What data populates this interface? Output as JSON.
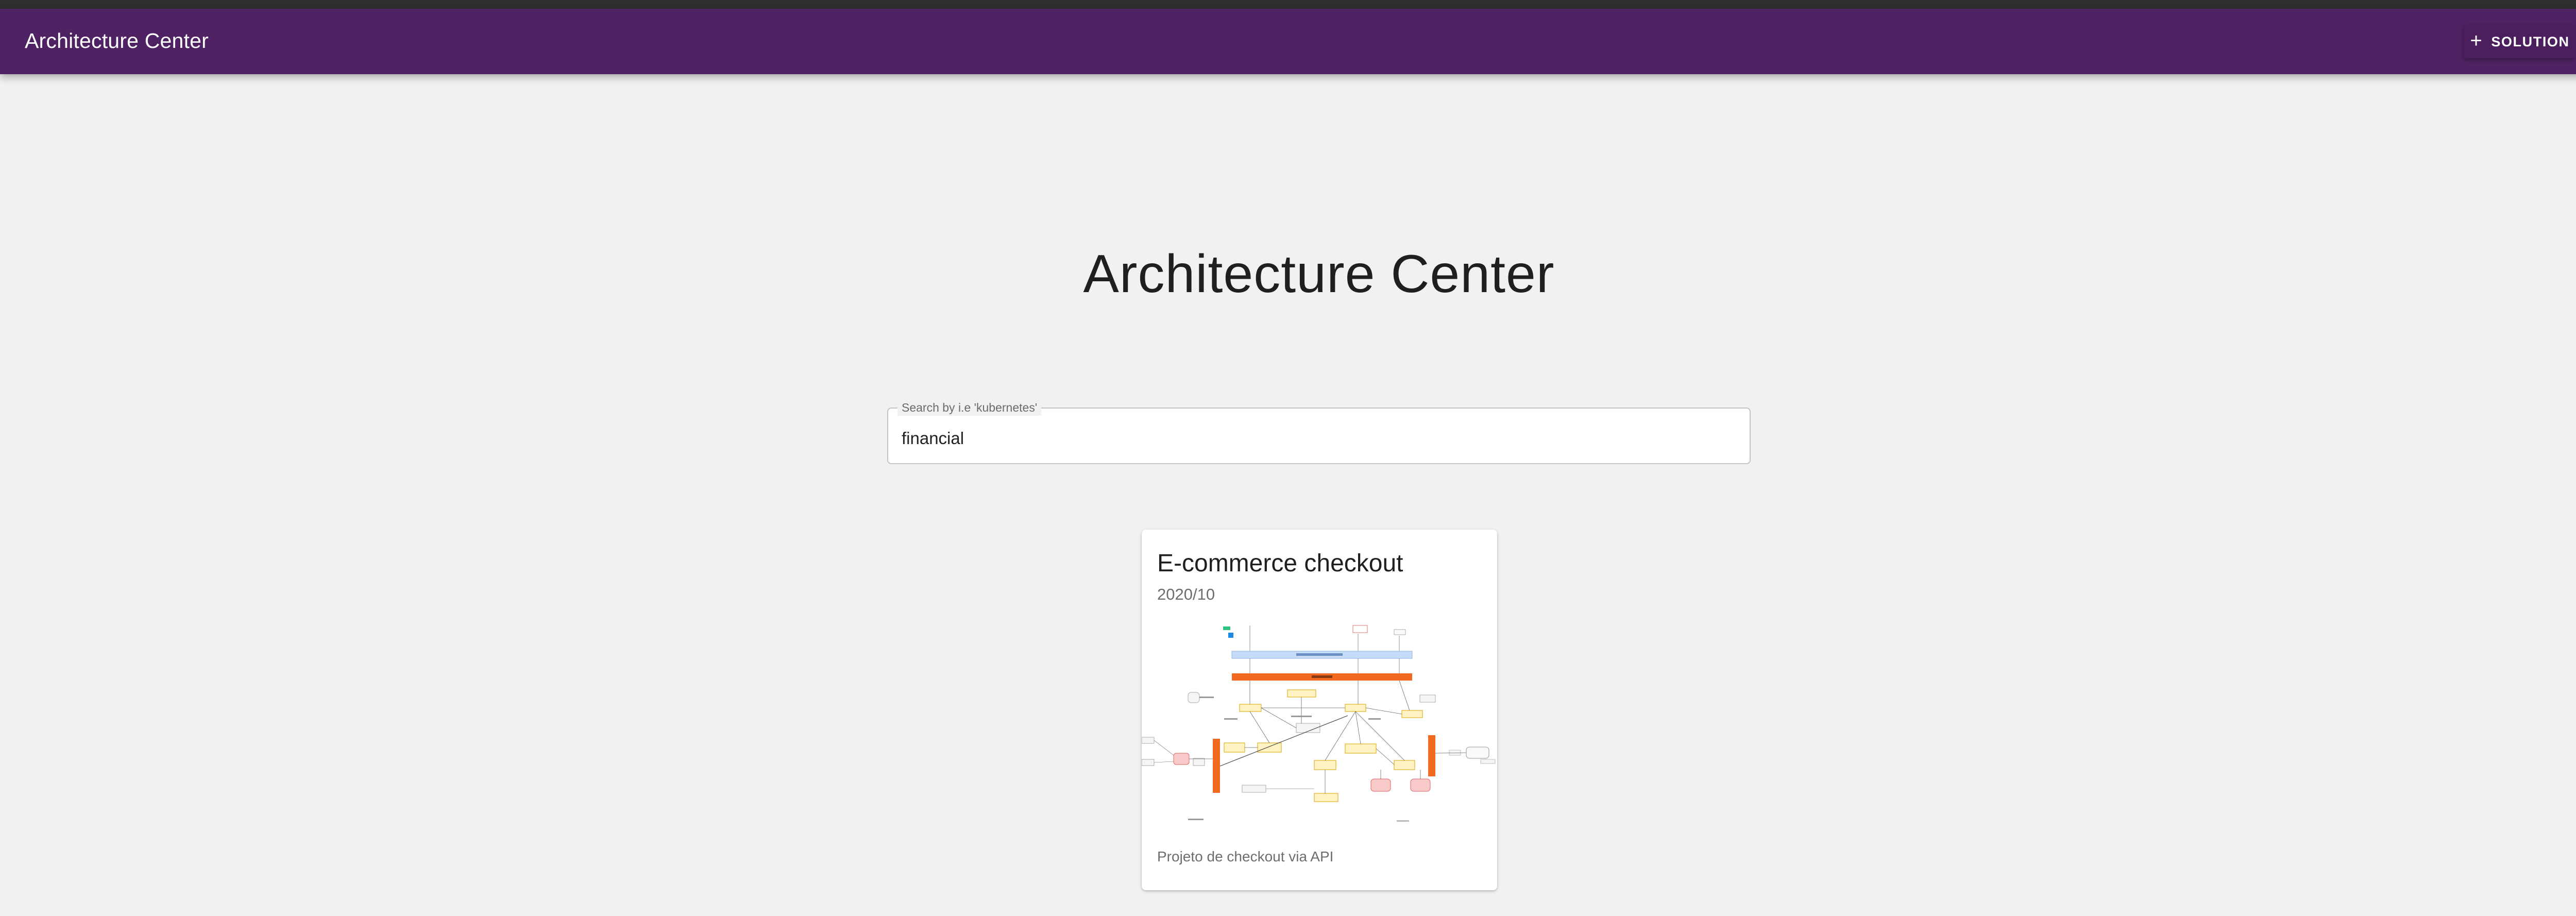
{
  "header": {
    "title": "Architecture Center",
    "solution_button": "SOLUTION",
    "account_icon": "account-circle-icon",
    "add_icon": "plus-icon"
  },
  "main": {
    "title": "Architecture Center",
    "search": {
      "label": "Search by i.e 'kubernetes'",
      "value": "financial"
    }
  },
  "results": [
    {
      "title": "E-commerce checkout",
      "date": "2020/10",
      "description": "Projeto de checkout via API",
      "image_alt": "architecture-diagram-thumbnail"
    }
  ],
  "colors": {
    "appbar": "#4f2263",
    "background": "#f1f1f1",
    "diagram_orange": "#f26a21",
    "diagram_blue": "#c6dbf5"
  }
}
